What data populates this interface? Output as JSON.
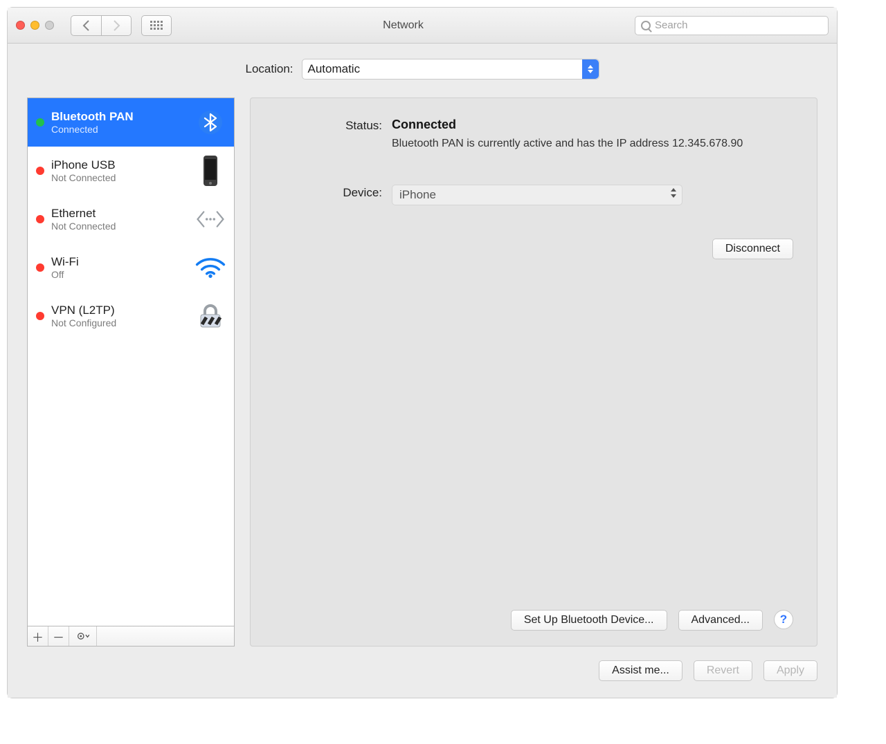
{
  "window_title": "Network",
  "search_placeholder": "Search",
  "location": {
    "label": "Location:",
    "value": "Automatic"
  },
  "interfaces": [
    {
      "name": "Bluetooth PAN",
      "status": "Connected",
      "status_color": "green",
      "icon": "bluetooth",
      "selected": true
    },
    {
      "name": "iPhone USB",
      "status": "Not Connected",
      "status_color": "red",
      "icon": "iphone",
      "selected": false
    },
    {
      "name": "Ethernet",
      "status": "Not Connected",
      "status_color": "red",
      "icon": "ethernet",
      "selected": false
    },
    {
      "name": "Wi-Fi",
      "status": "Off",
      "status_color": "red",
      "icon": "wifi",
      "selected": false
    },
    {
      "name": "VPN (L2TP)",
      "status": "Not Configured",
      "status_color": "red",
      "icon": "vpn",
      "selected": false
    }
  ],
  "detail": {
    "status_label": "Status:",
    "status_value": "Connected",
    "status_description": "Bluetooth PAN is currently active and has the IP address 12.345.678.90",
    "device_label": "Device:",
    "device_value": "iPhone",
    "disconnect_button": "Disconnect",
    "setup_button": "Set Up Bluetooth Device...",
    "advanced_button": "Advanced..."
  },
  "bottom": {
    "assist": "Assist me...",
    "revert": "Revert",
    "apply": "Apply"
  }
}
